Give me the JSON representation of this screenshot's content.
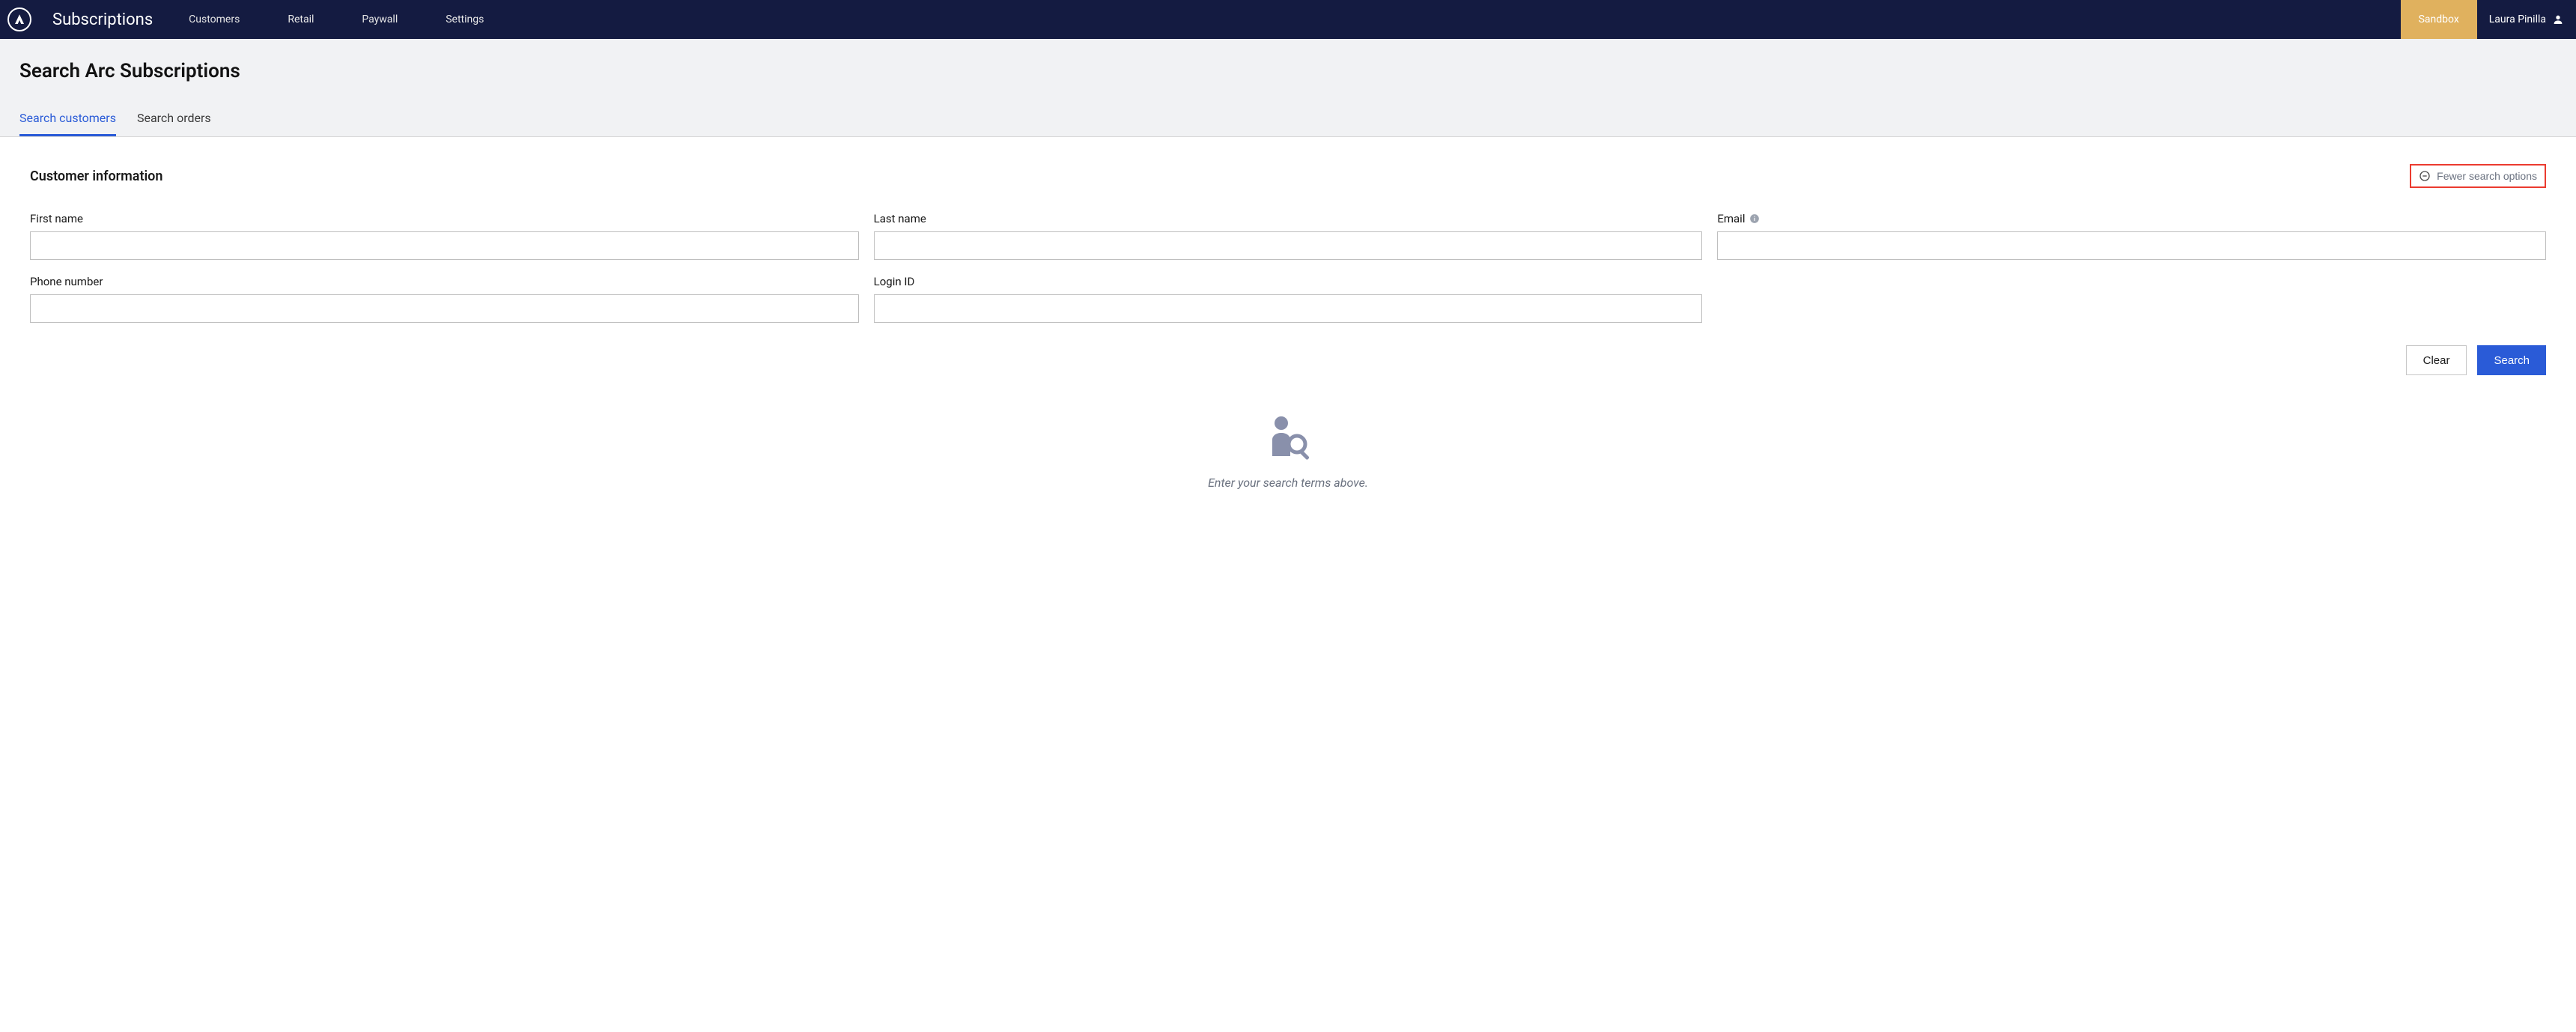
{
  "header": {
    "app_title": "Subscriptions",
    "nav": [
      {
        "label": "Customers"
      },
      {
        "label": "Retail"
      },
      {
        "label": "Paywall"
      },
      {
        "label": "Settings"
      }
    ],
    "env_badge": "Sandbox",
    "user_name": "Laura Pinilla"
  },
  "page": {
    "title": "Search Arc Subscriptions",
    "tabs": [
      {
        "label": "Search customers",
        "active": true
      },
      {
        "label": "Search orders",
        "active": false
      }
    ]
  },
  "form": {
    "section_title": "Customer information",
    "toggle_label": "Fewer search options",
    "fields": {
      "first_name": {
        "label": "First name",
        "value": ""
      },
      "last_name": {
        "label": "Last name",
        "value": ""
      },
      "email": {
        "label": "Email",
        "value": ""
      },
      "phone": {
        "label": "Phone number",
        "value": ""
      },
      "login_id": {
        "label": "Login ID",
        "value": ""
      }
    },
    "buttons": {
      "clear": "Clear",
      "search": "Search"
    }
  },
  "empty_state": {
    "message": "Enter your search terms above."
  }
}
